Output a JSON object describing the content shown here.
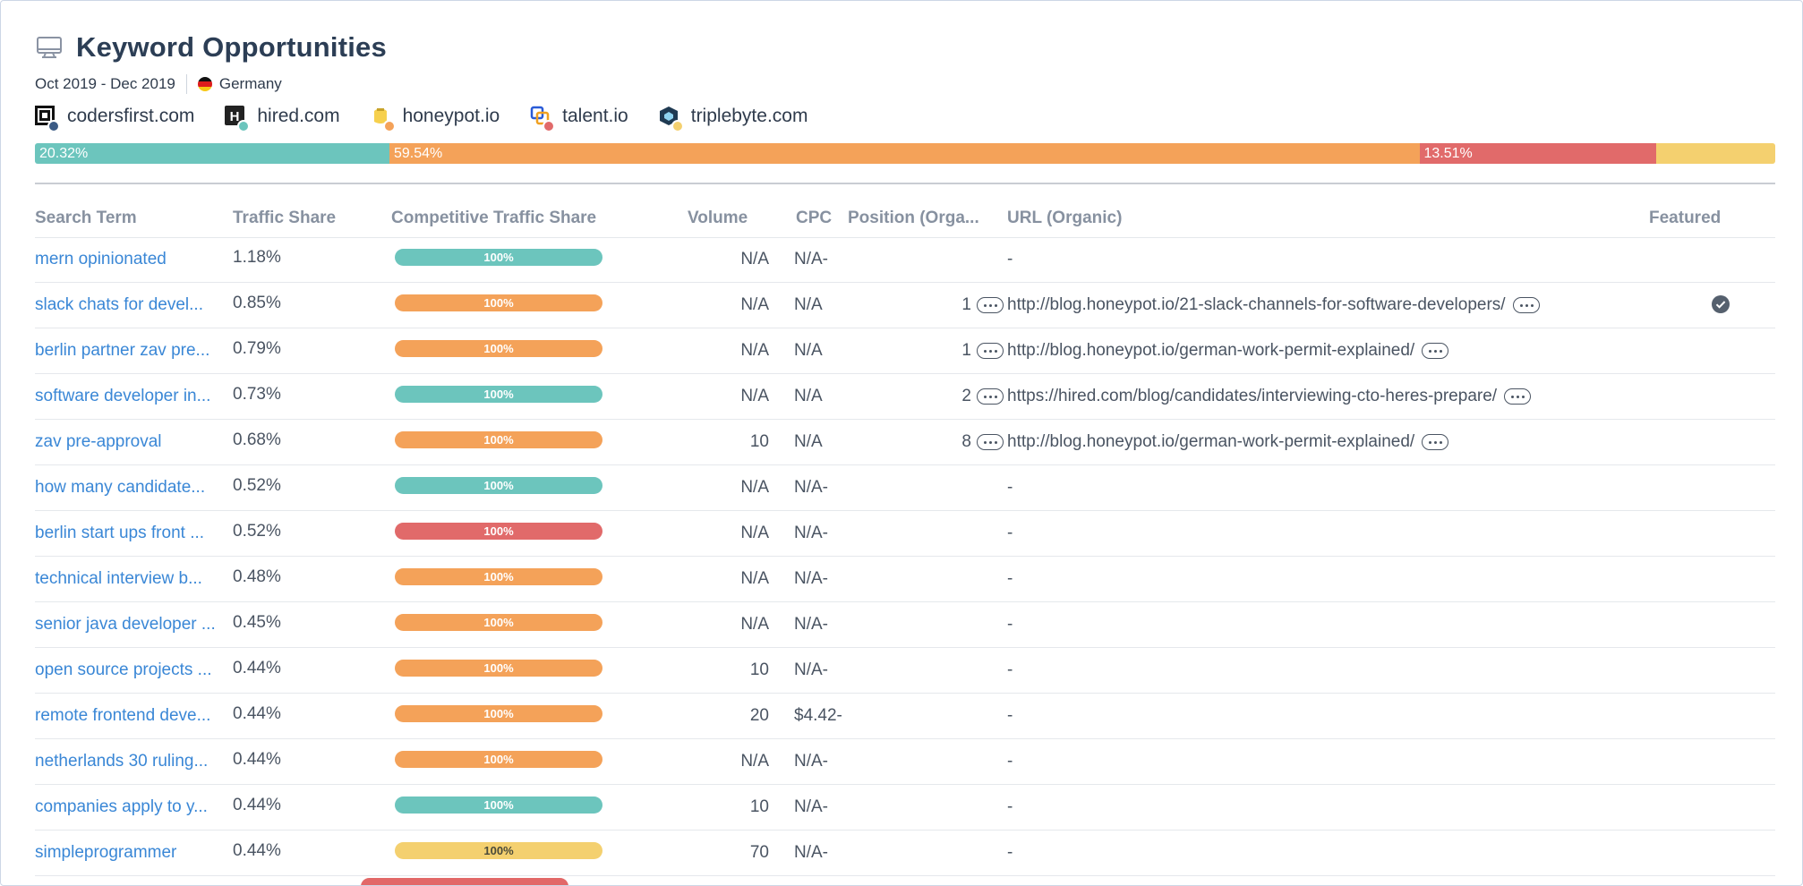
{
  "header": {
    "title": "Keyword Opportunities",
    "date_range": "Oct 2019 - Dec 2019",
    "country": "Germany"
  },
  "sites": [
    {
      "name": "codersfirst.com",
      "color": "#3b5b85"
    },
    {
      "name": "hired.com",
      "color": "#6cc5bd"
    },
    {
      "name": "honeypot.io",
      "color": "#f4a259"
    },
    {
      "name": "talent.io",
      "color": "#e16a6a"
    },
    {
      "name": "triplebyte.com",
      "color": "#f4d06f"
    }
  ],
  "share_bar": [
    {
      "label": "20.32%",
      "value": 20.32,
      "color": "#6cc5bd"
    },
    {
      "label": "59.54%",
      "value": 59.54,
      "color": "#f4a259"
    },
    {
      "label": "13.51%",
      "value": 13.51,
      "color": "#e16a6a"
    },
    {
      "label": "",
      "value": 6.63,
      "color": "#f4d06f"
    }
  ],
  "columns": {
    "search_term": "Search Term",
    "traffic_share": "Traffic Share",
    "competitive": "Competitive Traffic Share",
    "volume": "Volume",
    "cpc": "CPC",
    "position": "Position (Orga...",
    "url": "URL (Organic)",
    "featured": "Featured"
  },
  "rows": [
    {
      "term": "mern opinionated",
      "share": "1.18%",
      "bar": "100%",
      "bar_color": "#6cc5bd",
      "volume": "N/A",
      "cpc": "N/A-",
      "position": "",
      "url": "-",
      "featured": false
    },
    {
      "term": "slack chats for devel...",
      "share": "0.85%",
      "bar": "100%",
      "bar_color": "#f4a259",
      "volume": "N/A",
      "cpc": "N/A",
      "position": "1",
      "url": "http://blog.honeypot.io/21-slack-channels-for-software-developers/",
      "featured": true
    },
    {
      "term": "berlin partner zav pre...",
      "share": "0.79%",
      "bar": "100%",
      "bar_color": "#f4a259",
      "volume": "N/A",
      "cpc": "N/A",
      "position": "1",
      "url": "http://blog.honeypot.io/german-work-permit-explained/",
      "featured": false
    },
    {
      "term": "software developer in...",
      "share": "0.73%",
      "bar": "100%",
      "bar_color": "#6cc5bd",
      "volume": "N/A",
      "cpc": "N/A",
      "position": "2",
      "url": "https://hired.com/blog/candidates/interviewing-cto-heres-prepare/",
      "featured": false
    },
    {
      "term": "zav pre-approval",
      "share": "0.68%",
      "bar": "100%",
      "bar_color": "#f4a259",
      "volume": "10",
      "cpc": "N/A",
      "position": "8",
      "url": "http://blog.honeypot.io/german-work-permit-explained/",
      "featured": false
    },
    {
      "term": "how many candidate...",
      "share": "0.52%",
      "bar": "100%",
      "bar_color": "#6cc5bd",
      "volume": "N/A",
      "cpc": "N/A-",
      "position": "",
      "url": "-",
      "featured": false
    },
    {
      "term": "berlin start ups front ...",
      "share": "0.52%",
      "bar": "100%",
      "bar_color": "#e16a6a",
      "volume": "N/A",
      "cpc": "N/A-",
      "position": "",
      "url": "-",
      "featured": false
    },
    {
      "term": "technical interview b...",
      "share": "0.48%",
      "bar": "100%",
      "bar_color": "#f4a259",
      "volume": "N/A",
      "cpc": "N/A-",
      "position": "",
      "url": "-",
      "featured": false
    },
    {
      "term": "senior java developer ...",
      "share": "0.45%",
      "bar": "100%",
      "bar_color": "#f4a259",
      "volume": "N/A",
      "cpc": "N/A-",
      "position": "",
      "url": "-",
      "featured": false
    },
    {
      "term": "open source projects ...",
      "share": "0.44%",
      "bar": "100%",
      "bar_color": "#f4a259",
      "volume": "10",
      "cpc": "N/A-",
      "position": "",
      "url": "-",
      "featured": false
    },
    {
      "term": "remote frontend deve...",
      "share": "0.44%",
      "bar": "100%",
      "bar_color": "#f4a259",
      "volume": "20",
      "cpc": "$4.42-",
      "position": "",
      "url": "-",
      "featured": false
    },
    {
      "term": "netherlands 30 ruling...",
      "share": "0.44%",
      "bar": "100%",
      "bar_color": "#f4a259",
      "volume": "N/A",
      "cpc": "N/A-",
      "position": "",
      "url": "-",
      "featured": false
    },
    {
      "term": "companies apply to y...",
      "share": "0.44%",
      "bar": "100%",
      "bar_color": "#6cc5bd",
      "volume": "10",
      "cpc": "N/A-",
      "position": "",
      "url": "-",
      "featured": false
    },
    {
      "term": "simpleprogrammer",
      "share": "0.44%",
      "bar": "100%",
      "bar_color": "#f4d06f",
      "volume": "70",
      "cpc": "N/A-",
      "position": "",
      "url": "-",
      "featured": false
    }
  ]
}
